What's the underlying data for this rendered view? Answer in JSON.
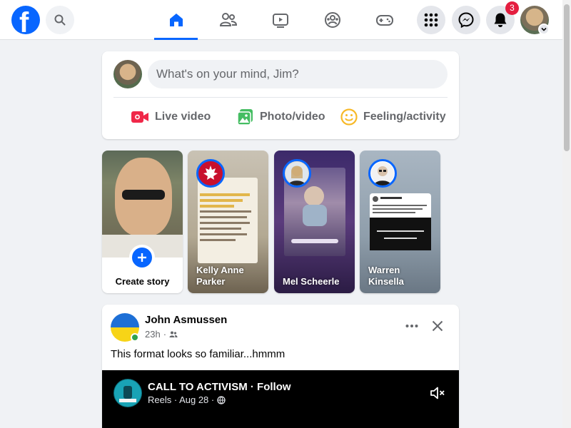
{
  "topbar": {
    "logo_letter": "f",
    "notification_count": "3",
    "nav_tabs": [
      {
        "name": "home",
        "active": true
      },
      {
        "name": "friends",
        "active": false
      },
      {
        "name": "video",
        "active": false
      },
      {
        "name": "groups",
        "active": false
      },
      {
        "name": "gaming",
        "active": false
      }
    ],
    "accent_color": "#0866ff"
  },
  "composer": {
    "placeholder": "What's on your mind, Jim?",
    "actions": [
      {
        "label": "Live video",
        "icon": "live-video-icon",
        "color": "#f02849"
      },
      {
        "label": "Photo/video",
        "icon": "photo-icon",
        "color": "#45bd62"
      },
      {
        "label": "Feeling/activity",
        "icon": "feeling-icon",
        "color": "#f7b928"
      }
    ]
  },
  "stories": {
    "create_label": "Create story",
    "items": [
      {
        "name": "Kelly Anne\nParker"
      },
      {
        "name": "Mel Scheerle"
      },
      {
        "name": "Warren\nKinsella"
      }
    ]
  },
  "post": {
    "author": "John Asmussen",
    "time": "23h",
    "separator": "·",
    "text": "This format looks so familiar...hmmm",
    "reel": {
      "title": "CALL TO ACTIVISM · Follow",
      "meta": "Reels · Aug 28 ·"
    }
  }
}
